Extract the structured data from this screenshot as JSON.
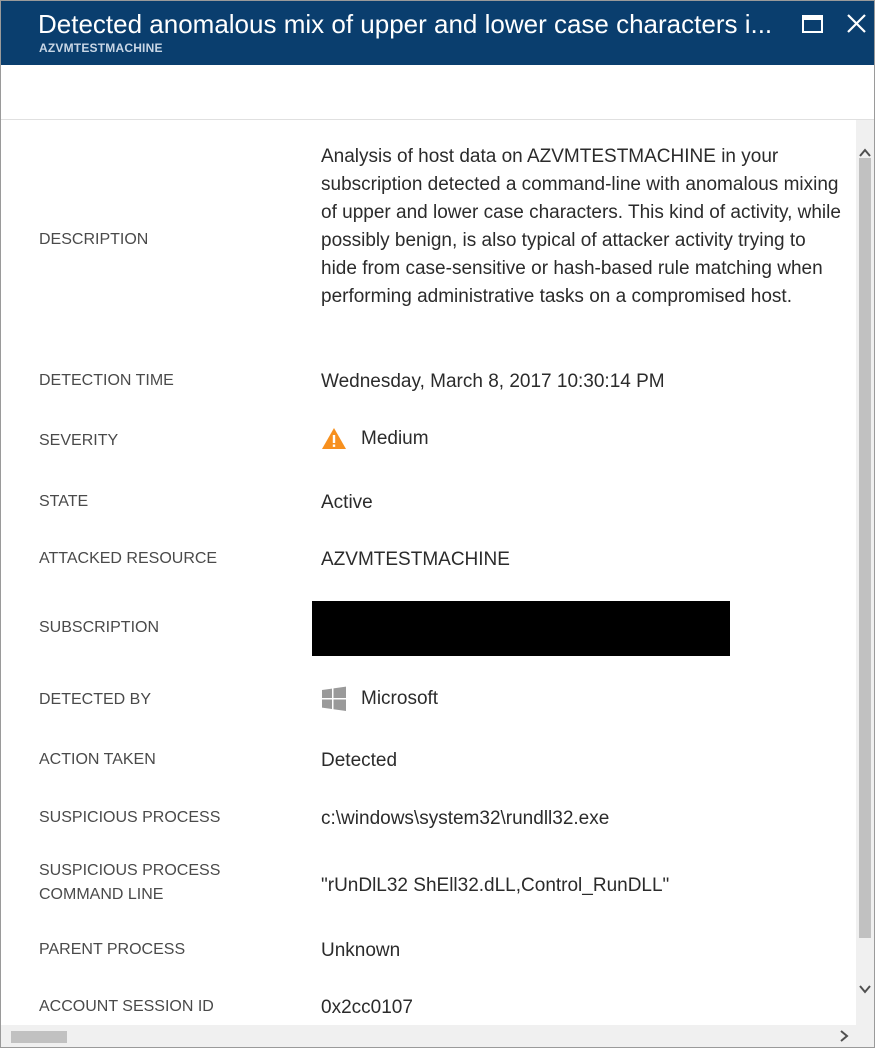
{
  "window": {
    "title": "Detected anomalous mix of upper and lower case characters i...",
    "subtitle": "AZVMTESTMACHINE",
    "accent_color": "#0a3e6e"
  },
  "details": {
    "description": {
      "label": "DESCRIPTION",
      "value": "Analysis of host data on AZVMTESTMACHINE in your subscription detected a command-line with anomalous mixing of upper and lower case characters. This kind of activity, while possibly benign, is also typical of attacker activity trying to hide from case-sensitive or hash-based rule matching when performing administrative tasks on a compromised host."
    },
    "detection_time": {
      "label": "DETECTION TIME",
      "value": "Wednesday, March 8, 2017 10:30:14 PM"
    },
    "severity": {
      "label": "SEVERITY",
      "value": "Medium",
      "icon": "warning-icon",
      "icon_color": "#f7901e"
    },
    "state": {
      "label": "STATE",
      "value": "Active"
    },
    "attacked_resource": {
      "label": "ATTACKED RESOURCE",
      "value": "AZVMTESTMACHINE"
    },
    "subscription": {
      "label": "SUBSCRIPTION",
      "value_redacted": true
    },
    "detected_by": {
      "label": "DETECTED BY",
      "value": "Microsoft",
      "icon": "windows-logo-icon",
      "icon_color": "#999999"
    },
    "action_taken": {
      "label": "ACTION TAKEN",
      "value": "Detected"
    },
    "suspicious_process": {
      "label": "SUSPICIOUS PROCESS",
      "value": "c:\\windows\\system32\\rundll32.exe"
    },
    "suspicious_process_command_line": {
      "label_line1": "SUSPICIOUS PROCESS",
      "label_line2": "COMMAND LINE",
      "value": "\"rUnDlL32  ShEll32.dLL,Control_RunDLL\""
    },
    "parent_process": {
      "label": "PARENT PROCESS",
      "value": "Unknown"
    },
    "account_session_id": {
      "label": "ACCOUNT SESSION ID",
      "value": "0x2cc0107"
    }
  }
}
